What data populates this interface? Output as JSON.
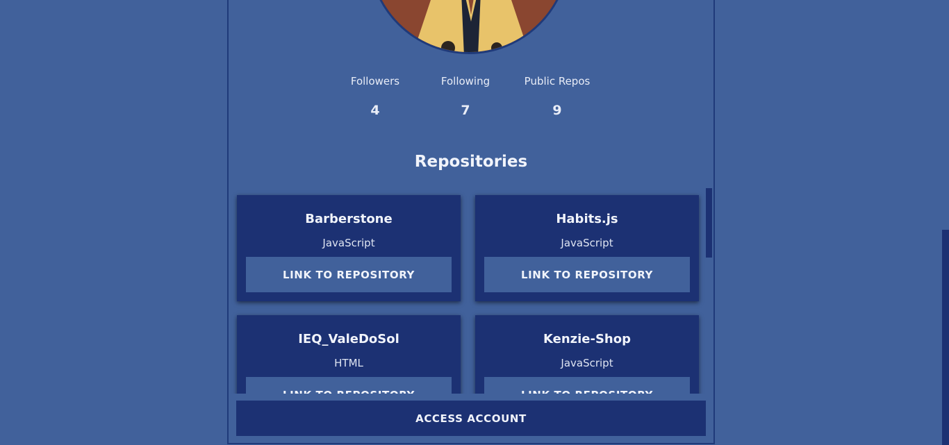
{
  "profile": {
    "stats": [
      {
        "label": "Followers",
        "value": "4"
      },
      {
        "label": "Following",
        "value": "7"
      },
      {
        "label": "Public Repos",
        "value": "9"
      }
    ]
  },
  "repositories": {
    "title": "Repositories",
    "items": [
      {
        "name": "Barberstone",
        "language": "JavaScript",
        "link_label": "LINK TO REPOSITORY"
      },
      {
        "name": "Habits.js",
        "language": "JavaScript",
        "link_label": "LINK TO REPOSITORY"
      },
      {
        "name": "IEQ_ValeDoSol",
        "language": "HTML",
        "link_label": "LINK TO REPOSITORY"
      },
      {
        "name": "Kenzie-Shop",
        "language": "JavaScript",
        "link_label": "LINK TO REPOSITORY"
      }
    ]
  },
  "actions": {
    "access_account": "ACCESS ACCOUNT"
  },
  "colors": {
    "background": "#41619b",
    "card": "#1c3173",
    "border": "#1f3a7a"
  }
}
